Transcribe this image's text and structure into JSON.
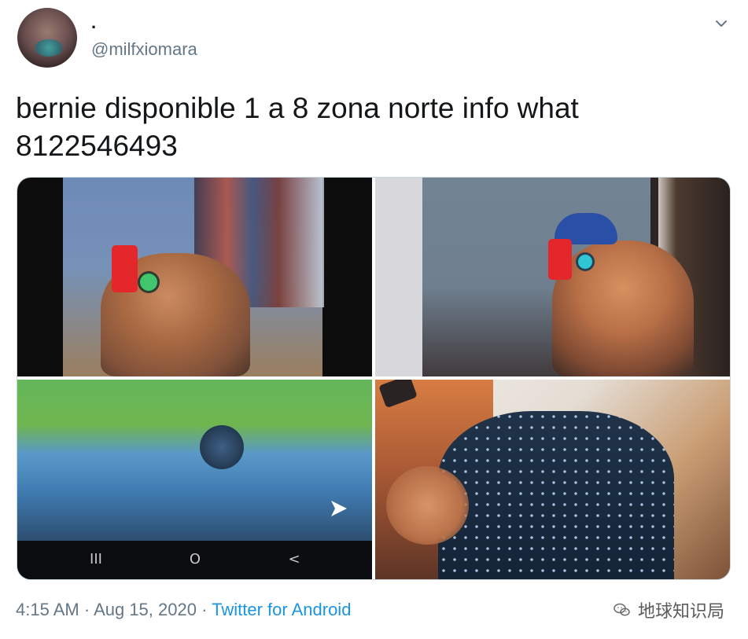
{
  "author": {
    "display_name": ".",
    "username": "@milfxiomara"
  },
  "tweet": {
    "text": "bernie disponible 1 a 8 zona norte info what\n8122546493"
  },
  "media": {
    "nav_buttons": {
      "recent": "III",
      "home": "O",
      "back": "<"
    }
  },
  "footer": {
    "time": "4:15 AM",
    "separator": " · ",
    "date": "Aug 15, 2020",
    "source": "Twitter for Android"
  },
  "watermark": {
    "text": "地球知识局",
    "icon": "wechat-icon"
  },
  "icons": {
    "menu": "chevron-down-icon",
    "play": "play-arrow-icon"
  },
  "colors": {
    "link": "#1b95e0",
    "muted": "#657786",
    "text": "#14171a",
    "border": "#ccd6dd"
  }
}
